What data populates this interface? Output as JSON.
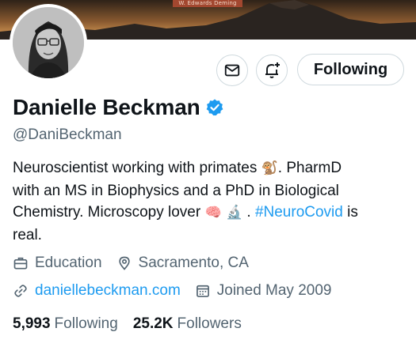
{
  "banner": {
    "caption": "W. Edwards Deming",
    "colors": {
      "sky_dark": "#3a2a1c",
      "sky_glow": "#e0a35a",
      "mountain": "#2a2420"
    }
  },
  "avatar": {
    "icon": "profile-photo"
  },
  "actions": {
    "message_icon": "mail-icon",
    "notify_icon": "bell-plus-icon",
    "follow_label": "Following"
  },
  "profile": {
    "display_name": "Danielle Beckman",
    "verified": true,
    "handle": "@DaniBeckman"
  },
  "bio": {
    "line1_text": "Neuroscientist working with primates ",
    "line1_emoji": "🐒",
    "line1_tail": ". PharmD",
    "line2": "with an MS in Biophysics and a PhD in Biological",
    "line3_text": "Chemistry.  Microscopy lover ",
    "line3_emoji1": "🧠",
    "line3_emoji2": "🔬",
    "line3_sep": " . ",
    "hashtag": "#NeuroCovid",
    "line3_tail": " is",
    "line4": "real."
  },
  "meta": {
    "category": "Education",
    "location": "Sacramento, CA",
    "website": "daniellebeckman.com",
    "joined": "Joined May 2009"
  },
  "stats": {
    "following_count": "5,993",
    "following_label": "Following",
    "followers_count": "25.2K",
    "followers_label": "Followers"
  },
  "colors": {
    "accent": "#1d9bf0",
    "text": "#0f1419",
    "secondary": "#536471",
    "border": "#cfd9de"
  }
}
